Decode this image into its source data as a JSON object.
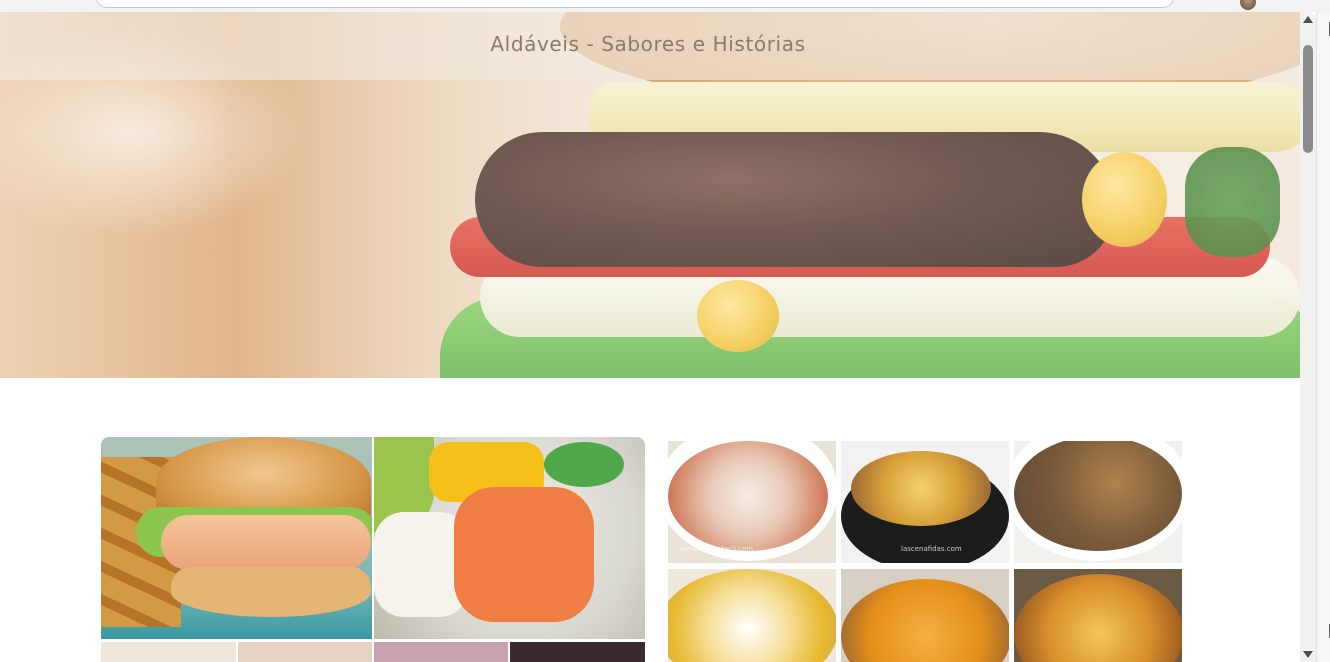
{
  "site": {
    "title": "Aldáveis - Sabores e Histórias"
  },
  "browser": {
    "address_bar": ""
  },
  "hero": {
    "image": "burger-hero-photo"
  },
  "gallery_left": {
    "tiles": [
      {
        "name": "chicken-burger-with-fries"
      },
      {
        "name": "salmon-poke-bowl"
      }
    ]
  },
  "gallery_right": {
    "tiles": [
      {
        "name": "bean-stew",
        "label": "www.cocinafacil.com"
      },
      {
        "name": "meatball-potato-stew",
        "label": "lascenafidas.com"
      },
      {
        "name": "lentil-stew",
        "label": ""
      },
      {
        "name": "egg-potato-soup",
        "label": ""
      },
      {
        "name": "seafood-rice-soup",
        "label": ""
      },
      {
        "name": "meat-potato-stew",
        "label": ""
      }
    ]
  },
  "colors": {
    "title_text": "#8a7a70",
    "title_band": "#f2eae0",
    "scroll_thumb": "#8b8b8b"
  }
}
